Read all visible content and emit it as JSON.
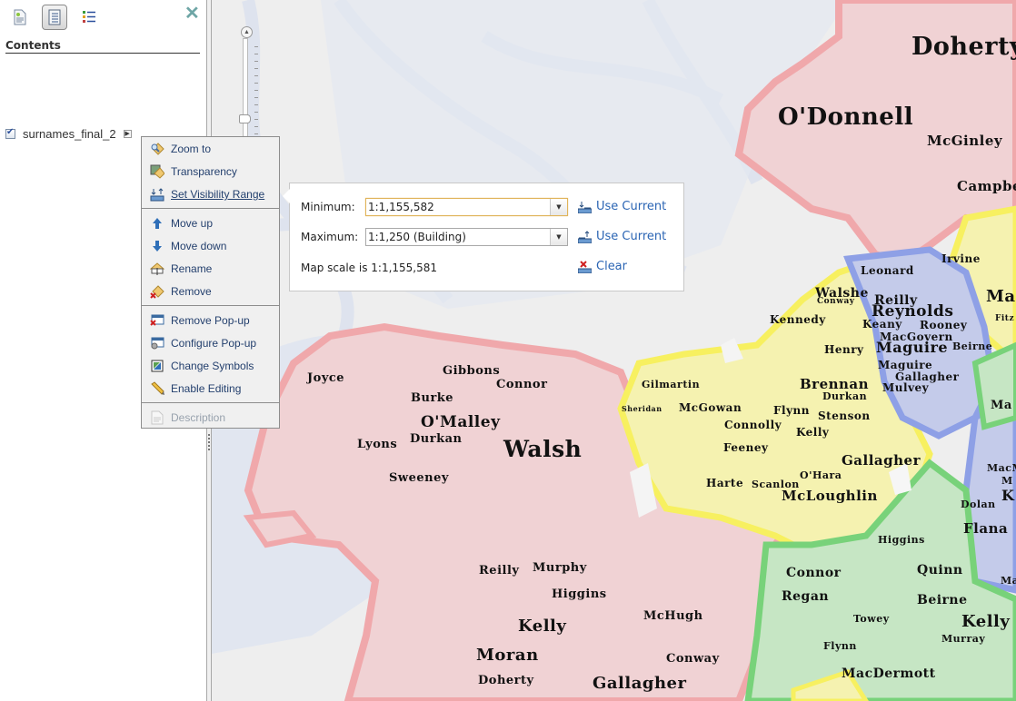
{
  "left_panel": {
    "toolbar": [
      {
        "icon": "details-icon",
        "active": false
      },
      {
        "icon": "contents-icon",
        "active": true
      },
      {
        "icon": "legend-icon",
        "active": false
      }
    ],
    "close_icon": "close-icon",
    "title": "Contents",
    "layer": {
      "name": "surnames_final_2",
      "checked": true,
      "arrow_icon": "triangle-right-icon"
    }
  },
  "context_menu": {
    "items": [
      {
        "label": "Zoom to",
        "icon": "zoom-to-icon",
        "enabled": true
      },
      {
        "label": "Transparency",
        "icon": "transparency-icon",
        "enabled": true
      },
      {
        "label": "Set Visibility Range",
        "icon": "visibility-range-icon",
        "enabled": true,
        "hovered": true
      },
      {
        "label": "Move up",
        "icon": "arrow-up-icon",
        "enabled": true
      },
      {
        "label": "Move down",
        "icon": "arrow-down-icon",
        "enabled": true
      },
      {
        "label": "Rename",
        "icon": "rename-icon",
        "enabled": true
      },
      {
        "label": "Remove",
        "icon": "remove-icon",
        "enabled": true
      },
      {
        "label": "Remove Pop-up",
        "icon": "remove-popup-icon",
        "enabled": true
      },
      {
        "label": "Configure Pop-up",
        "icon": "configure-popup-icon",
        "enabled": true
      },
      {
        "label": "Change Symbols",
        "icon": "change-symbols-icon",
        "enabled": true
      },
      {
        "label": "Enable Editing",
        "icon": "pencil-icon",
        "enabled": true
      },
      {
        "label": "Description",
        "icon": "description-icon",
        "enabled": false
      }
    ]
  },
  "visibility_range": {
    "minimum_label": "Minimum:",
    "minimum_value": "1:1,155,582",
    "maximum_label": "Maximum:",
    "maximum_value": "1:1,250 (Building)",
    "use_current_label": "Use Current",
    "map_scale_text": "Map scale is 1:1,155,581",
    "clear_label": "Clear",
    "link_color": "#2b65b4"
  },
  "map": {
    "zoom_in_icon": "zoom-in-icon",
    "region_colors": {
      "red": "#f0d2d4",
      "yellow": "#f5f2b0",
      "blue": "#c4cbea",
      "green": "#c6e6c4",
      "water": "#e1e6f0",
      "land": "#eeeeee"
    },
    "labels": [
      {
        "text": "Doherty",
        "size": "xl"
      },
      {
        "text": "O'Donnell",
        "size": "xl"
      },
      {
        "text": "McGinley",
        "size": "m"
      },
      {
        "text": "Campbell",
        "size": "m"
      },
      {
        "text": "Irvine",
        "size": "s"
      },
      {
        "text": "Leonard",
        "size": "s"
      },
      {
        "text": "Maguire",
        "size": "l"
      },
      {
        "text": "Walshe",
        "size": "m"
      },
      {
        "text": "Conway",
        "size": "xs"
      },
      {
        "text": "Reilly",
        "size": "m"
      },
      {
        "text": "Reynolds",
        "size": "l"
      },
      {
        "text": "Kennedy",
        "size": "s"
      },
      {
        "text": "Keany",
        "size": "s"
      },
      {
        "text": "Rooney",
        "size": "s"
      },
      {
        "text": "Fitz",
        "size": "xs"
      },
      {
        "text": "MacGovern",
        "size": "s"
      },
      {
        "text": "Henry",
        "size": "s"
      },
      {
        "text": "Maguire",
        "size": "l"
      },
      {
        "text": "Beirne",
        "size": "s"
      },
      {
        "text": "Maguire",
        "size": "s"
      },
      {
        "text": "Gallagher",
        "size": "s"
      },
      {
        "text": "Mulvey",
        "size": "s"
      },
      {
        "text": "Brennan",
        "size": "m"
      },
      {
        "text": "Durkan",
        "size": "s"
      },
      {
        "text": "Gilmartin",
        "size": "s"
      },
      {
        "text": "Sheridan",
        "size": "xs"
      },
      {
        "text": "McGowan",
        "size": "s"
      },
      {
        "text": "Flynn",
        "size": "s"
      },
      {
        "text": "Stenson",
        "size": "s"
      },
      {
        "text": "Connolly",
        "size": "s"
      },
      {
        "text": "Kelly",
        "size": "s"
      },
      {
        "text": "Feeney",
        "size": "s"
      },
      {
        "text": "Gallagher",
        "size": "m"
      },
      {
        "text": "O'Hara",
        "size": "s"
      },
      {
        "text": "Harte",
        "size": "s"
      },
      {
        "text": "Scanlon",
        "size": "s"
      },
      {
        "text": "McLoughlin",
        "size": "m"
      },
      {
        "text": "Joyce",
        "size": "s"
      },
      {
        "text": "Gibbons",
        "size": "s"
      },
      {
        "text": "Connor",
        "size": "s"
      },
      {
        "text": "Burke",
        "size": "s"
      },
      {
        "text": "O'Malley",
        "size": "m"
      },
      {
        "text": "Lyons",
        "size": "s"
      },
      {
        "text": "Durkan",
        "size": "s"
      },
      {
        "text": "Walsh",
        "size": "xl"
      },
      {
        "text": "Sweeney",
        "size": "s"
      },
      {
        "text": "Reilly",
        "size": "s"
      },
      {
        "text": "Murphy",
        "size": "s"
      },
      {
        "text": "Higgins",
        "size": "s"
      },
      {
        "text": "Kelly",
        "size": "m"
      },
      {
        "text": "McHugh",
        "size": "s"
      },
      {
        "text": "Moran",
        "size": "m"
      },
      {
        "text": "Conway",
        "size": "s"
      },
      {
        "text": "Doherty",
        "size": "s"
      },
      {
        "text": "Gallagher",
        "size": "m"
      },
      {
        "text": "Higgins",
        "size": "s"
      },
      {
        "text": "Connor",
        "size": "s"
      },
      {
        "text": "Quinn",
        "size": "s"
      },
      {
        "text": "Regan",
        "size": "s"
      },
      {
        "text": "Beirne",
        "size": "s"
      },
      {
        "text": "Towey",
        "size": "xs"
      },
      {
        "text": "Kelly",
        "size": "m"
      },
      {
        "text": "Murray",
        "size": "xs"
      },
      {
        "text": "Flynn",
        "size": "xs"
      },
      {
        "text": "MacDermott",
        "size": "s"
      },
      {
        "text": "Ma",
        "size": "s"
      },
      {
        "text": "MacM",
        "size": "xs"
      },
      {
        "text": "Dolan",
        "size": "xs"
      },
      {
        "text": "K",
        "size": "m"
      },
      {
        "text": "M",
        "size": "xs"
      },
      {
        "text": "Flana",
        "size": "m"
      },
      {
        "text": "Ma",
        "size": "xs"
      }
    ]
  }
}
